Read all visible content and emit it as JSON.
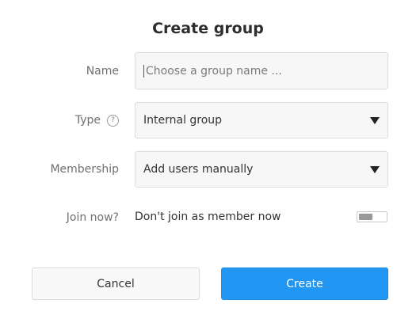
{
  "dialog": {
    "title": "Create group"
  },
  "form": {
    "name": {
      "label": "Name",
      "value": "",
      "placeholder": "Choose a group name ..."
    },
    "type": {
      "label": "Type",
      "help_glyph": "?",
      "value": "Internal group"
    },
    "membership": {
      "label": "Membership",
      "value": "Add users manually"
    },
    "join_now": {
      "label": "Join now?",
      "text": "Don't join as member now",
      "toggle_on": false
    }
  },
  "buttons": {
    "cancel_label": "Cancel",
    "create_label": "Create"
  },
  "colors": {
    "primary": "#2196f3",
    "field_bg": "#f7f7f7",
    "border": "#dcdcdc"
  },
  "icons": {
    "type_help": "question-circle-icon",
    "select_caret": "caret-down-icon"
  }
}
